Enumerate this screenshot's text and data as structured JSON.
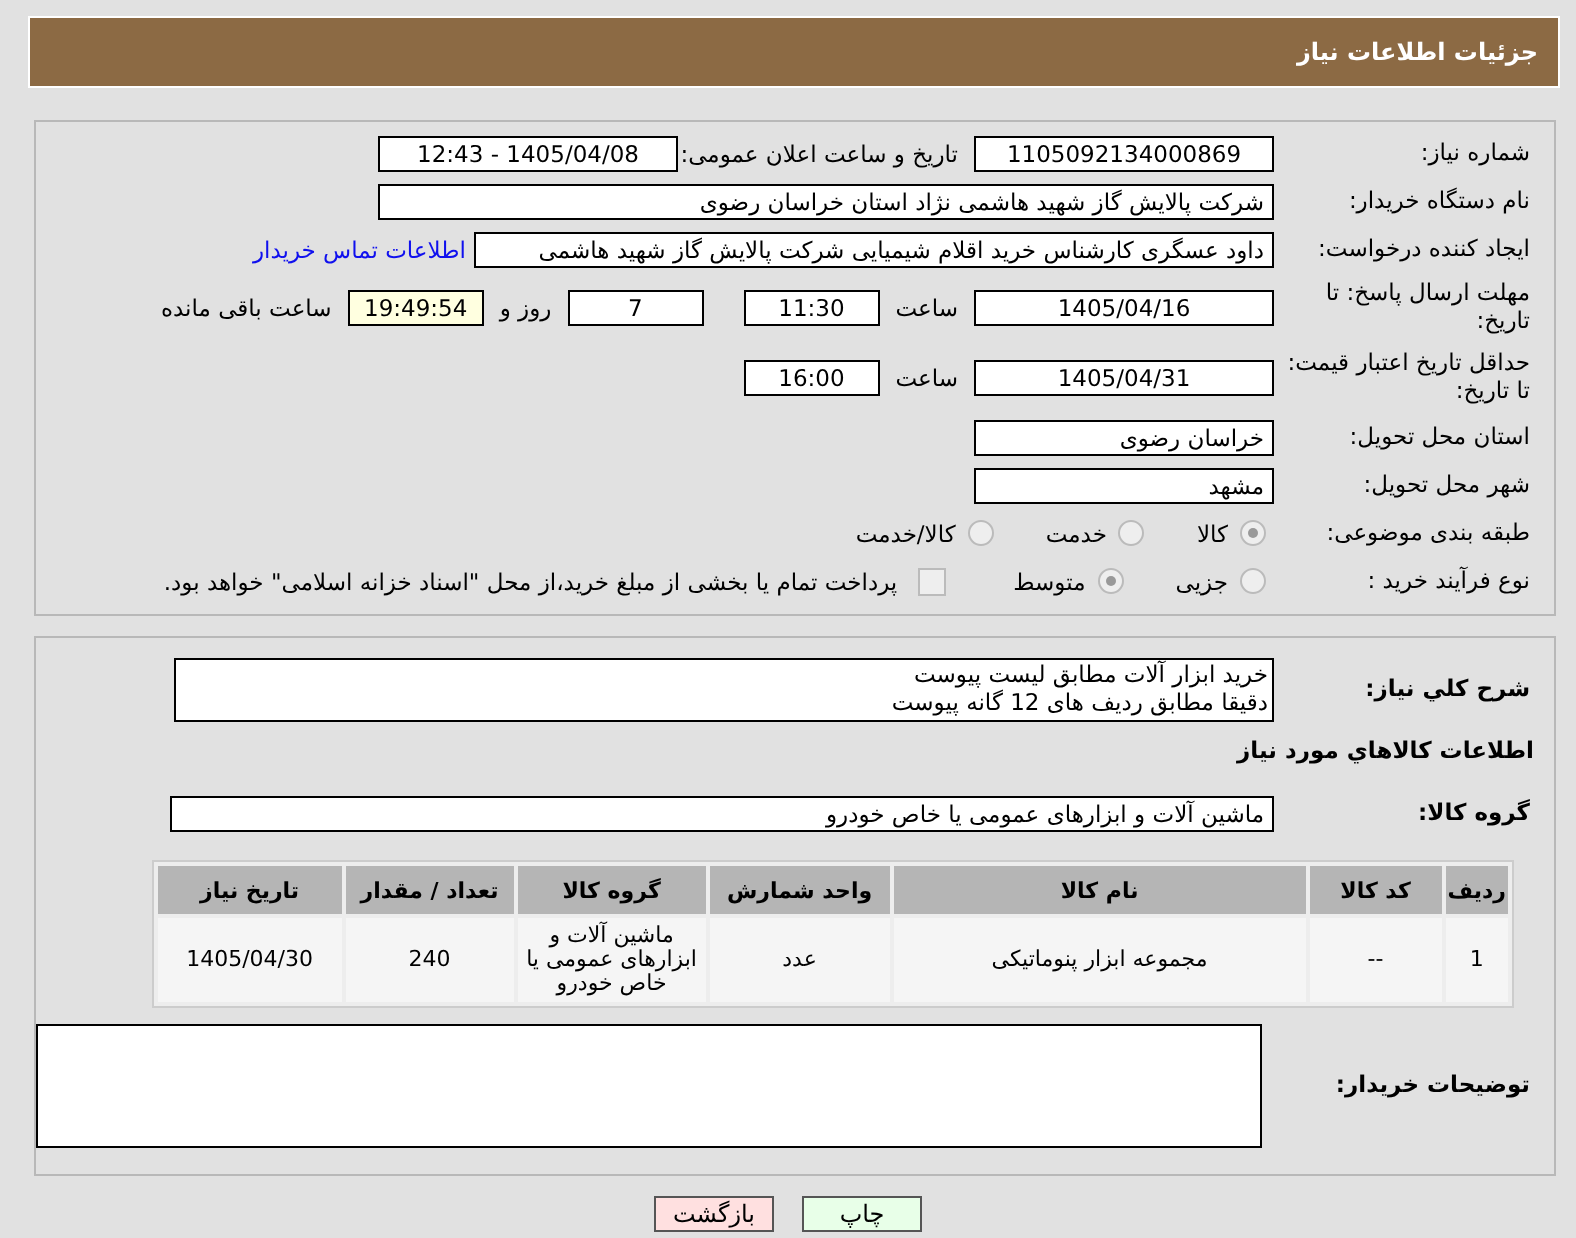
{
  "header": {
    "title": "جزئیات اطلاعات نیاز"
  },
  "need_number": {
    "label": "شماره نیاز:",
    "value": "1105092134000869"
  },
  "announce": {
    "label": "تاریخ و ساعت اعلان عمومی:",
    "value": "1405/04/08 - 12:43"
  },
  "buyer": {
    "label": "نام دستگاه خریدار:",
    "value": "شرکت پالایش گاز شهید هاشمی نژاد   استان خراسان رضوی"
  },
  "creator": {
    "label": "ایجاد کننده درخواست:",
    "value": "داود عسگری کارشناس خرید اقلام شیمیایی شرکت پالایش گاز شهید هاشمی",
    "link": "اطلاعات تماس خریدار"
  },
  "reply_deadline": {
    "label": "مهلت ارسال پاسخ: تا تاریخ:",
    "date": "1405/04/16",
    "time_label": "ساعت",
    "time": "11:30",
    "days": "7",
    "days_label": "روز و",
    "remaining": "19:49:54",
    "remaining_label": "ساعت باقی مانده"
  },
  "price_validity": {
    "label": "حداقل تاریخ اعتبار قیمت: تا تاریخ:",
    "date": "1405/04/31",
    "time_label": "ساعت",
    "time": "16:00"
  },
  "province": {
    "label": "استان محل تحویل:",
    "value": "خراسان رضوی"
  },
  "city": {
    "label": "شهر محل تحویل:",
    "value": "مشهد"
  },
  "category": {
    "label": "طبقه بندی موضوعی:",
    "options": [
      {
        "label": "کالا",
        "selected": true
      },
      {
        "label": "خدمت",
        "selected": false
      },
      {
        "label": "کالا/خدمت",
        "selected": false
      }
    ]
  },
  "process": {
    "label": "نوع فرآیند خرید :",
    "options": [
      {
        "label": "جزیی",
        "selected": false
      },
      {
        "label": "متوسط",
        "selected": true
      }
    ],
    "treasury": {
      "checked": false,
      "label": "پرداخت تمام یا بخشی از مبلغ خرید،از محل \"اسناد خزانه اسلامی\" خواهد بود."
    }
  },
  "description": {
    "label": "شرح كلي نياز:",
    "lines": [
      "خرید ابزار آلات مطابق لیست پیوست",
      "دقیقا مطابق ردیف های 12 گانه پیوست"
    ]
  },
  "goods_title": "اطلاعات كالاهاي مورد نياز",
  "goods_group": {
    "label": "گروه كالا:",
    "value": "ماشین آلات و ابزارهای عمومی یا خاص خودرو"
  },
  "table": {
    "columns": [
      "ردیف",
      "کد کالا",
      "نام کالا",
      "واحد شمارش",
      "گروه کالا",
      "تعداد / مقدار",
      "تاریخ نیاز"
    ],
    "rows": [
      [
        "1",
        "--",
        "مجموعه ابزار پنوماتیکی",
        "عدد",
        "ماشین آلات و ابزارهای عمومی یا خاص خودرو",
        "240",
        "1405/04/30"
      ]
    ]
  },
  "buyer_notes": {
    "label": "توضیحات خریدار:"
  },
  "buttons": [
    {
      "label": "چاپ",
      "kind": "print"
    },
    {
      "label": "بازگشت",
      "kind": "back"
    }
  ]
}
